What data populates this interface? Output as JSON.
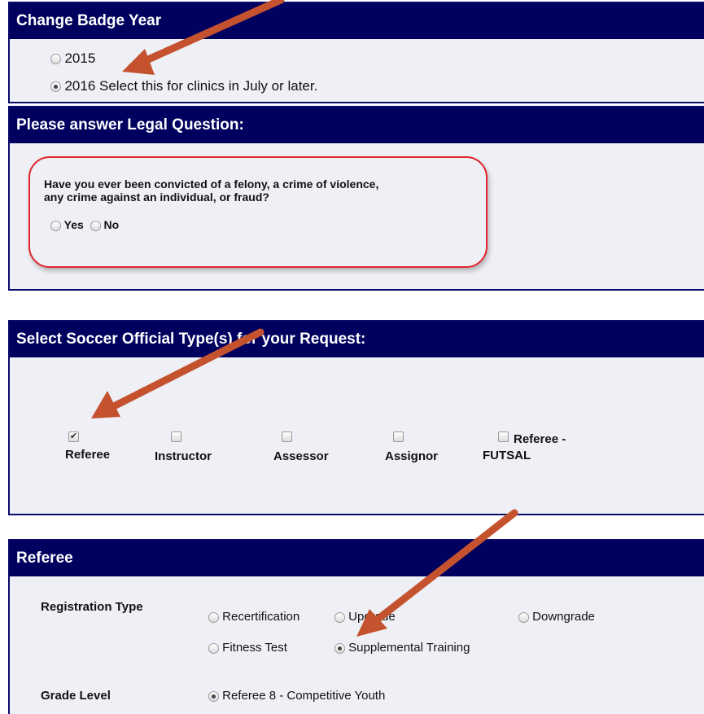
{
  "badge_year": {
    "title": "Change Badge Year",
    "options": [
      {
        "label": "2015",
        "selected": false
      },
      {
        "label": "2016 Select this for clinics in July or later.",
        "selected": true
      }
    ]
  },
  "legal": {
    "title": "Please answer Legal Question:",
    "question_line1": "Have you ever been convicted of a felony, a crime of violence,",
    "question_line2": "any crime against an individual, or fraud?",
    "yes_label": "Yes",
    "no_label": "No"
  },
  "official_types": {
    "title": "Select Soccer Official Type(s) for your Request:",
    "referee_label": "Referee",
    "instructor_label": "Instructor",
    "assessor_label": "Assessor",
    "assignor_label": "Assignor",
    "futsal_label_line1": "Referee -",
    "futsal_label_line2": "FUTSAL",
    "referee_checked": true
  },
  "referee_section": {
    "title": "Referee",
    "registration_type_label": "Registration Type",
    "recert_label": "Recertification",
    "upgrade_label": "Upgrade",
    "downgrade_label": "Downgrade",
    "fitness_label": "Fitness Test",
    "supplemental_label": "Supplemental Training",
    "grade_level_label": "Grade Level",
    "grade_value": "Referee 8 - Competitive Youth"
  },
  "colors": {
    "header_bg": "#00005e",
    "panel_bg": "#eef0f5",
    "annotation_arrow": "#c4522f",
    "highlight_oval": "#e0242b"
  }
}
